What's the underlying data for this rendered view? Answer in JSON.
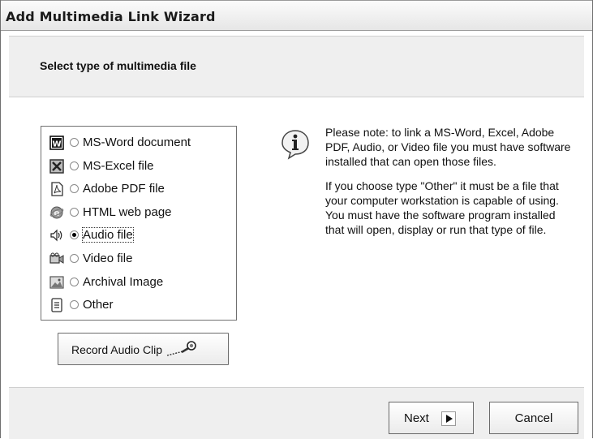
{
  "window": {
    "title": "Add Multimedia Link Wizard"
  },
  "header": {
    "text": "Select type of multimedia file"
  },
  "file_types": [
    {
      "label": "MS-Word document",
      "icon": "word-doc-icon",
      "selected": false
    },
    {
      "label": "MS-Excel file",
      "icon": "excel-file-icon",
      "selected": false
    },
    {
      "label": "Adobe PDF file",
      "icon": "pdf-file-icon",
      "selected": false
    },
    {
      "label": "HTML web page",
      "icon": "web-page-icon",
      "selected": false
    },
    {
      "label": "Audio file",
      "icon": "speaker-icon",
      "selected": true
    },
    {
      "label": "Video file",
      "icon": "video-camera-icon",
      "selected": false
    },
    {
      "label": "Archival Image",
      "icon": "image-icon",
      "selected": false
    },
    {
      "label": "Other",
      "icon": "document-icon",
      "selected": false
    }
  ],
  "record_button": {
    "label": "Record Audio Clip",
    "icon": "microphone-icon"
  },
  "note": {
    "icon": "info-icon",
    "p1": "Please note: to link a MS-Word, Excel, Adobe PDF, Audio, or Video file you must have software installed that can open those files.",
    "p2": "If you choose type \"Other\" it must be a file that your computer workstation is capable of using.  You must have the software program installed that will open, display or run that type of file."
  },
  "footer": {
    "next_label": "Next",
    "next_icon": "arrow-right-icon",
    "cancel_label": "Cancel"
  }
}
